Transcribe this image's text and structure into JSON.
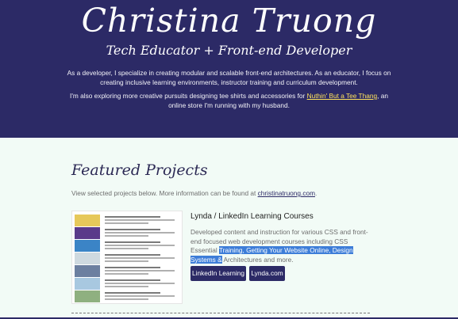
{
  "hero": {
    "name": "Christina Truong",
    "tagline": "Tech Educator + Front-end Developer",
    "para1": "As a developer, I specialize in creating modular and scalable front-end architectures. As an educator, I focus on creating inclusive learning environments, instructor training and curriculum development.",
    "para2_before": "I'm also exploring more creative pursuits designing tee shirts and accessories for ",
    "para2_link": "Nuthin' But a Tee Thang",
    "para2_after": ", an online store I'm running with my husband."
  },
  "featured": {
    "title": "Featured Projects",
    "intro_before": "View selected projects below. More information can be found at ",
    "intro_link": "christinatruong.com",
    "intro_after": "."
  },
  "project": {
    "title": "Lynda / LinkedIn Learning Courses",
    "desc_before": "Developed content and instruction for various CSS and front-end focused web development courses including CSS Essential ",
    "desc_highlight": "Training, Getting Your Website Online, Design Systems &",
    "desc_after": " Architectures and more.",
    "buttons": [
      "LinkedIn Learning",
      "Lynda.com"
    ]
  },
  "thumbnail_rows": [
    {
      "color": "#e6c85a"
    },
    {
      "color": "#5a3a8a"
    },
    {
      "color": "#3b84c6"
    },
    {
      "color": "#cfd9e0"
    },
    {
      "color": "#6c7fa0"
    },
    {
      "color": "#a8c8e0"
    },
    {
      "color": "#8fb080"
    }
  ]
}
